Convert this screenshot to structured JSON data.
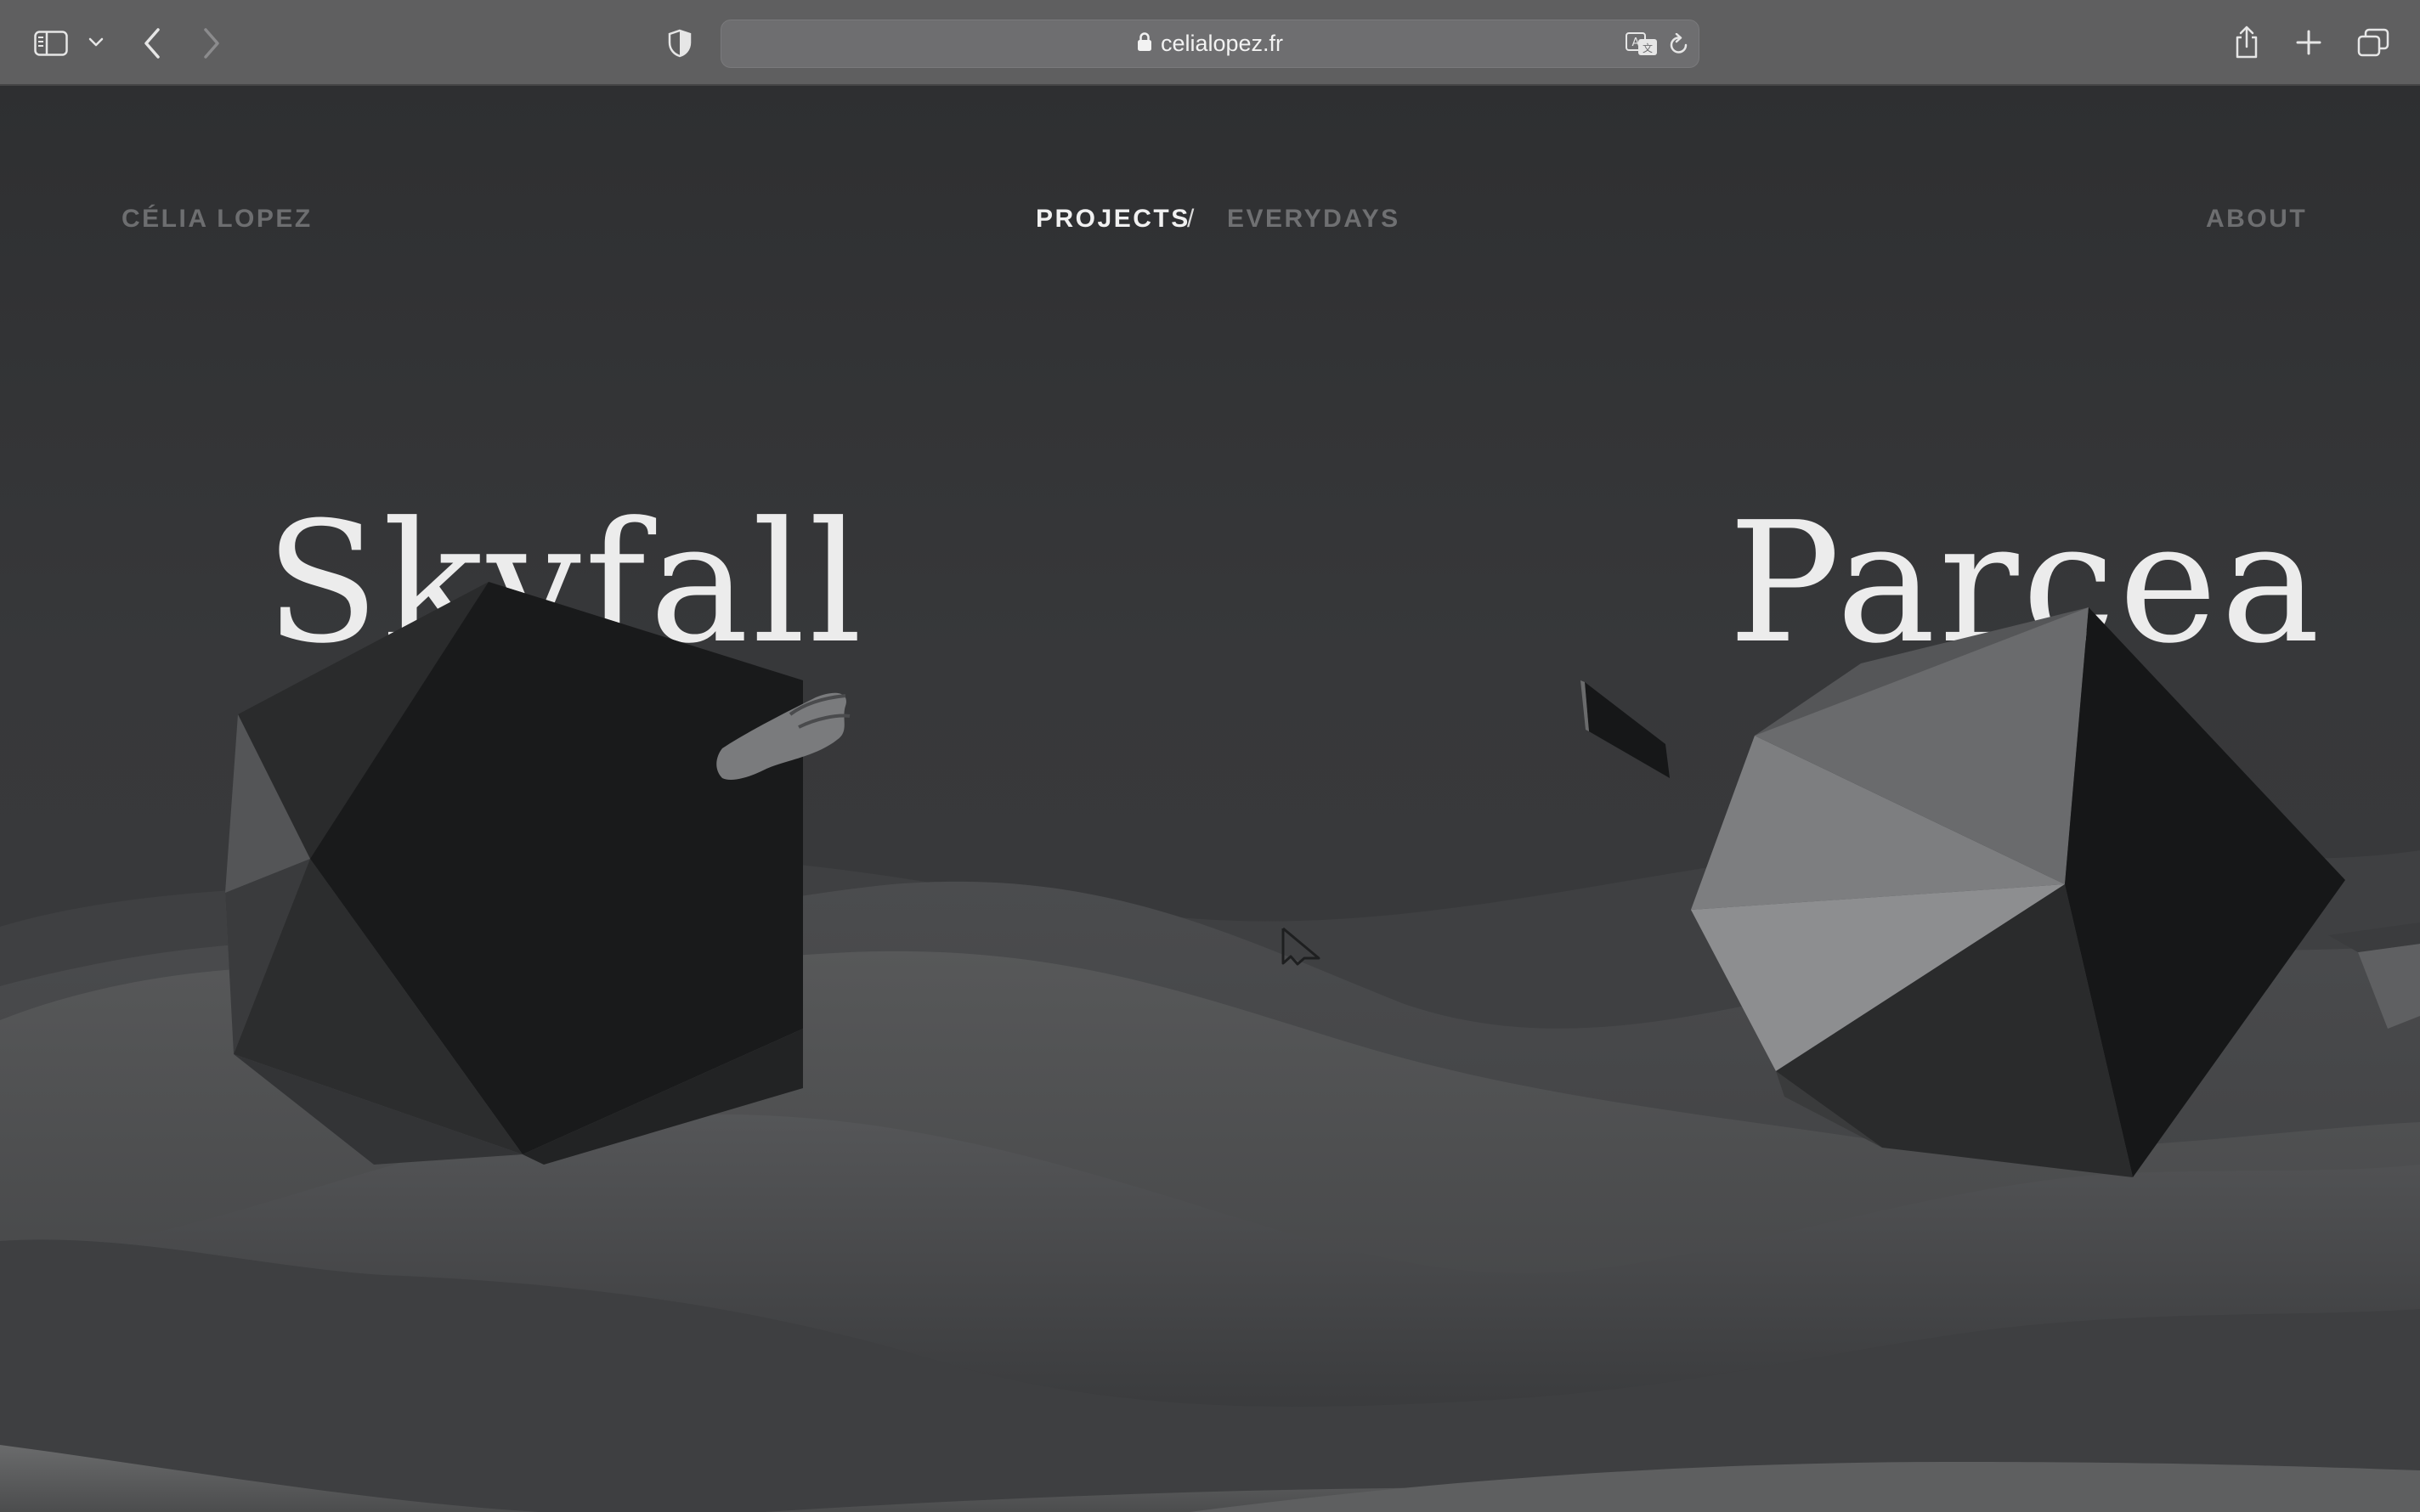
{
  "browser": {
    "url": "celialopez.fr",
    "icons": {
      "sidebar": "sidebar-toggle-icon",
      "sidebar_menu": "chevron-down-icon",
      "back": "chevron-left-icon",
      "forward": "chevron-right-icon",
      "privacy": "shield-icon",
      "lock": "lock-icon",
      "translate": "translate-icon",
      "reload": "reload-icon",
      "share": "share-icon",
      "new_tab": "plus-icon",
      "tabs": "tab-overview-icon"
    }
  },
  "site": {
    "brand": "CÉLIA LOPEZ",
    "nav": {
      "projects": "PROJECTS",
      "separator": "/",
      "everydays": "EVERYDAYS",
      "about": "ABOUT"
    },
    "projects": [
      {
        "title": "Skyfall"
      },
      {
        "title": "Parcea"
      }
    ]
  },
  "colors": {
    "chrome_bg": "#5f5f60",
    "page_bg": "#2f3032",
    "title_text": "#ececec",
    "nav_active": "#f1f1f1",
    "nav_inactive": "#6d6e70"
  }
}
